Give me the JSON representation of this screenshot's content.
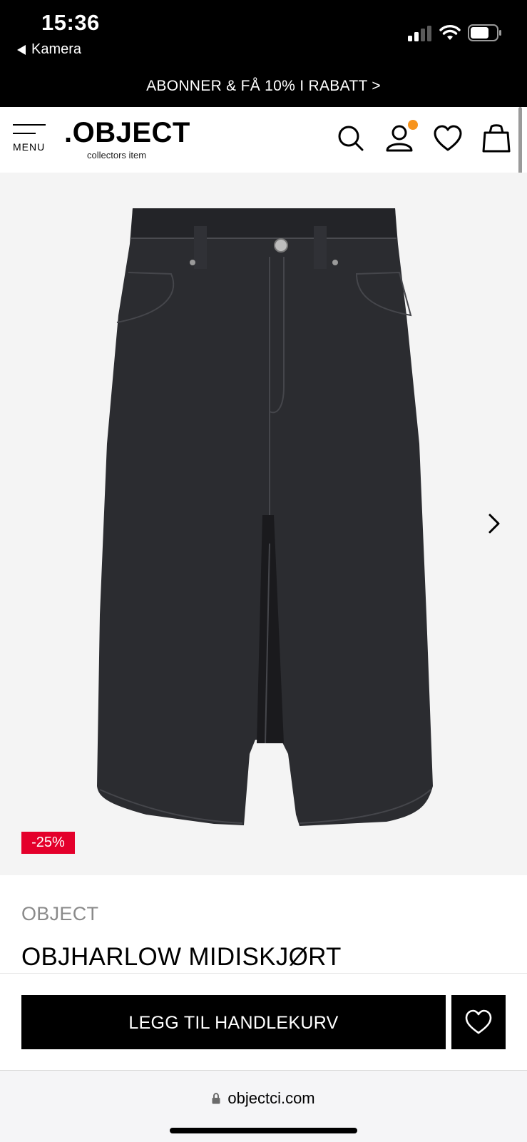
{
  "status_bar": {
    "time": "15:36",
    "back_app": "Kamera",
    "icons": [
      "signal-icon",
      "wifi-icon",
      "battery-icon"
    ]
  },
  "promo": {
    "text": "ABONNER & FÅ 10% I RABATT >"
  },
  "header": {
    "menu_label": "MENU",
    "logo_main": ".OBJECT",
    "logo_sub": "collectors item",
    "icons": [
      "search-icon",
      "account-icon",
      "wishlist-icon",
      "shopping-bag-icon"
    ],
    "notification_color": "#f7941d"
  },
  "product": {
    "image_subject": "black denim midi skirt",
    "discount_badge": "-25%",
    "brand": "OBJECT",
    "title": "OBJHARLOW MIDISKJØRT"
  },
  "actions": {
    "add_to_cart_label": "LEGG TIL HANDLEKURV"
  },
  "browser": {
    "url": "objectci.com"
  },
  "colors": {
    "accent_badge": "#e4002b",
    "primary_button": "#000000",
    "gallery_bg": "#f4f4f4"
  }
}
